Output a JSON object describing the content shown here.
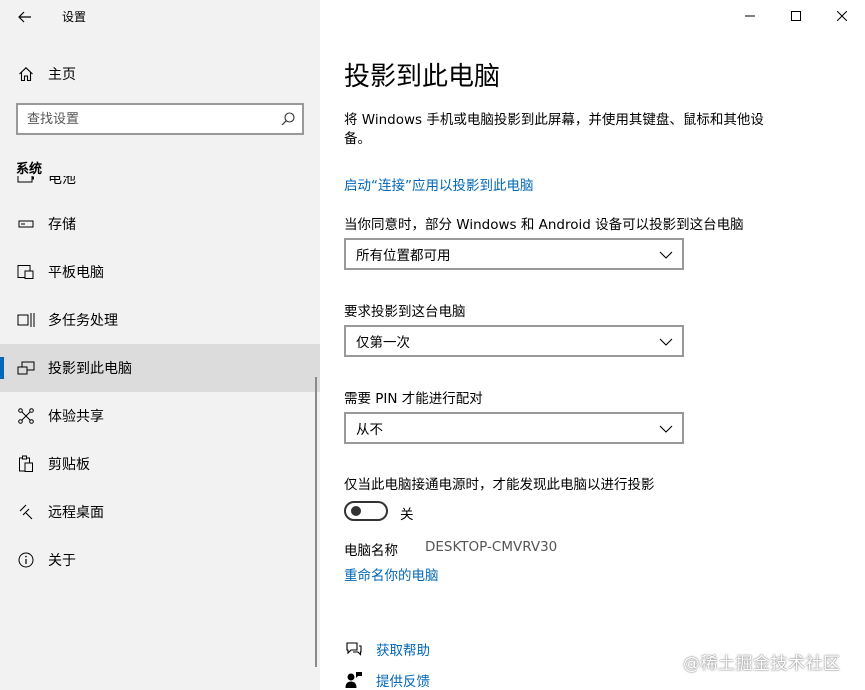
{
  "app": {
    "title": "设置"
  },
  "sidebar": {
    "home_label": "主页",
    "search_placeholder": "查找设置",
    "section_title": "系统",
    "items": [
      {
        "label": "电池",
        "icon": "battery-icon"
      },
      {
        "label": "存储",
        "icon": "storage-icon"
      },
      {
        "label": "平板电脑",
        "icon": "tablet-icon"
      },
      {
        "label": "多任务处理",
        "icon": "multitasking-icon"
      },
      {
        "label": "投影到此电脑",
        "icon": "project-icon",
        "active": true
      },
      {
        "label": "体验共享",
        "icon": "share-icon"
      },
      {
        "label": "剪贴板",
        "icon": "clipboard-icon"
      },
      {
        "label": "远程桌面",
        "icon": "remote-desktop-icon"
      },
      {
        "label": "关于",
        "icon": "info-icon"
      }
    ]
  },
  "main": {
    "title": "投影到此电脑",
    "description": "将 Windows 手机或电脑投影到此屏幕，并使用其键盘、鼠标和其他设备。",
    "launch_link": "启动“连接”应用以投影到此电脑",
    "setting1": {
      "label": "当你同意时，部分 Windows 和 Android 设备可以投影到这台电脑",
      "value": "所有位置都可用"
    },
    "setting2": {
      "label": "要求投影到这台电脑",
      "value": "仅第一次"
    },
    "setting3": {
      "label": "需要 PIN 才能进行配对",
      "value": "从不"
    },
    "power": {
      "label": "仅当此电脑接通电源时，才能发现此电脑以进行投影",
      "state": "关"
    },
    "pc_name": {
      "label": "电脑名称",
      "value": "DESKTOP-CMVRV30"
    },
    "rename_link": "重命名你的电脑",
    "help_link": "获取帮助",
    "feedback_link": "提供反馈"
  },
  "watermark": "@稀土掘金技术社区",
  "colors": {
    "accent": "#0067b8",
    "sidebar_bg": "#f2f2f2",
    "active_bg": "#dcdcdc"
  }
}
